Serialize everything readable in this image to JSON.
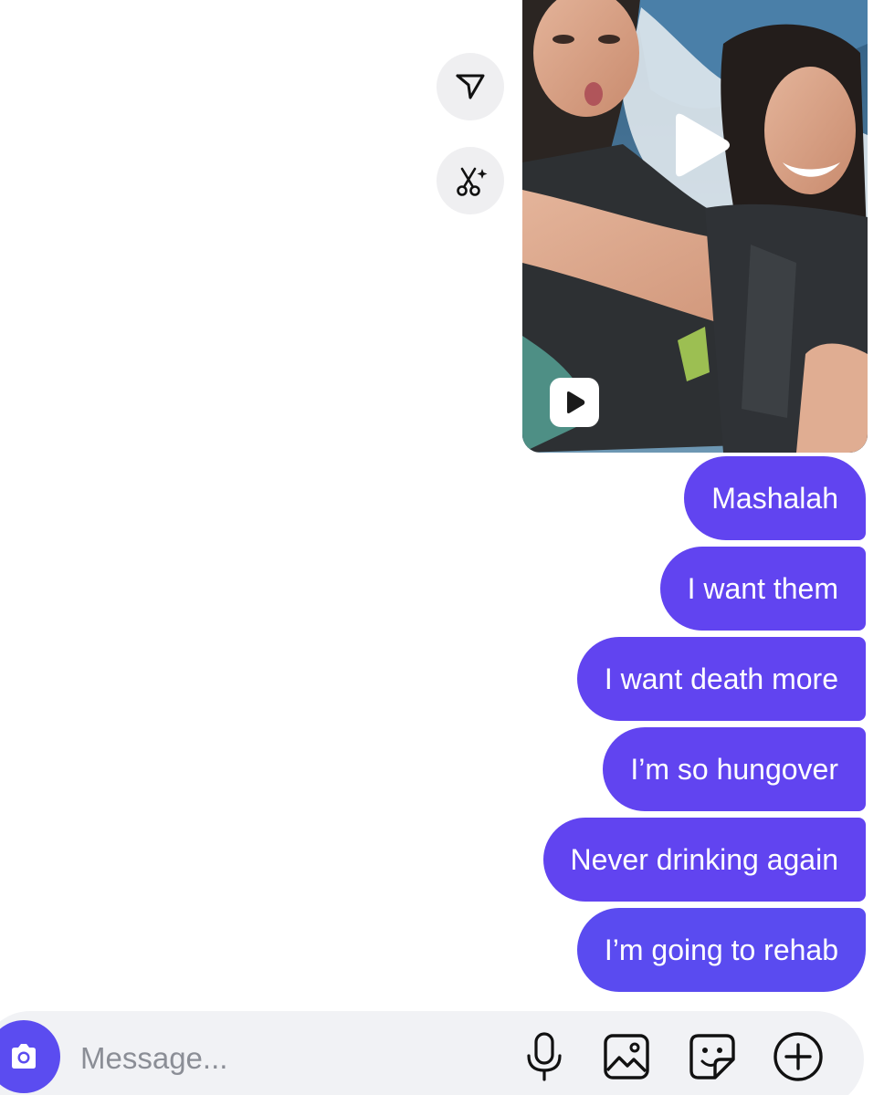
{
  "media": {
    "play_icon": "play-icon",
    "reel_icon": "reels-play-icon"
  },
  "side_actions": {
    "share_icon": "send-icon",
    "magic_icon": "scissors-sparkle-icon"
  },
  "messages": [
    {
      "text": "Mashalah"
    },
    {
      "text": "I want them"
    },
    {
      "text": "I want death more"
    },
    {
      "text": "I’m so hungover"
    },
    {
      "text": "Never drinking again"
    },
    {
      "text": "I’m going to rehab"
    }
  ],
  "composer": {
    "placeholder": "Message...",
    "value": "",
    "icons": [
      "camera-icon",
      "microphone-icon",
      "image-icon",
      "sticker-icon",
      "plus-circle-icon"
    ]
  },
  "colors": {
    "bubble": "#6144f0",
    "accent": "#5b4cf0",
    "composer_bg": "#f1f2f5"
  }
}
